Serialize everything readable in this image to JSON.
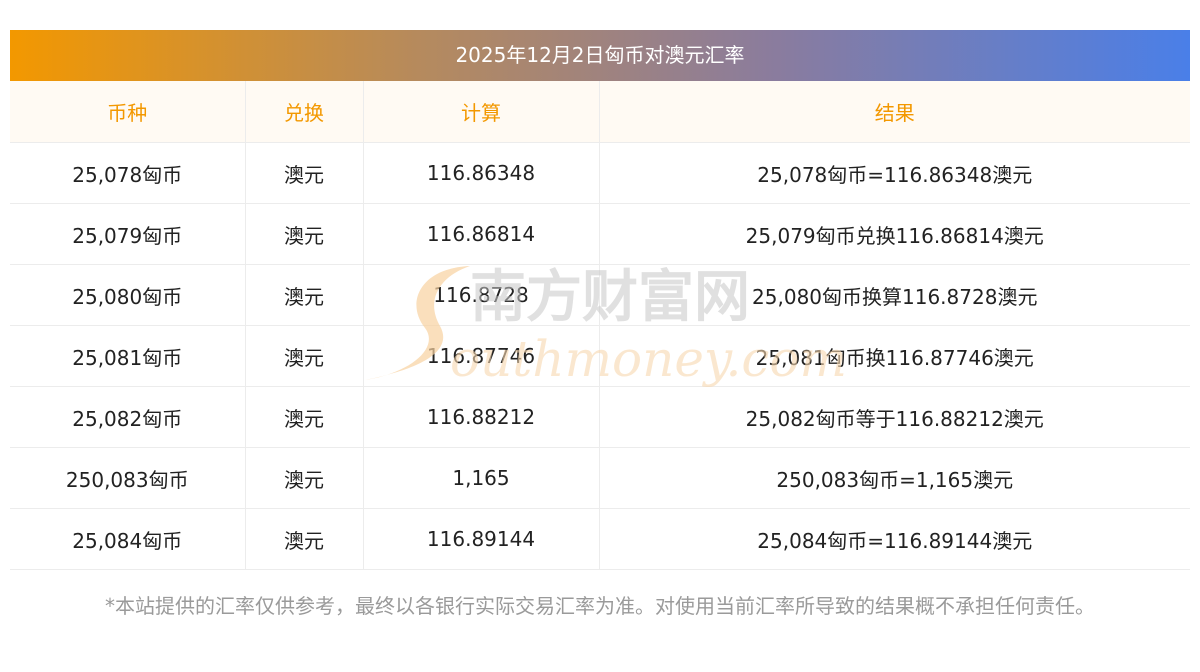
{
  "title": "2025年12月2日匈币对澳元汇率",
  "headers": [
    "币种",
    "兑换",
    "计算",
    "结果"
  ],
  "rows": [
    [
      "25,078匈币",
      "澳元",
      "116.86348",
      "25,078匈币=116.86348澳元"
    ],
    [
      "25,079匈币",
      "澳元",
      "116.86814",
      "25,079匈币兑换116.86814澳元"
    ],
    [
      "25,080匈币",
      "澳元",
      "116.8728",
      "25,080匈币换算116.8728澳元"
    ],
    [
      "25,081匈币",
      "澳元",
      "116.87746",
      "25,081匈币换116.87746澳元"
    ],
    [
      "25,082匈币",
      "澳元",
      "116.88212",
      "25,082匈币等于116.88212澳元"
    ],
    [
      "250,083匈币",
      "澳元",
      "1,165",
      "250,083匈币=1,165澳元"
    ],
    [
      "25,084匈币",
      "澳元",
      "116.89144",
      "25,084匈币=116.89144澳元"
    ]
  ],
  "watermark": {
    "cn": "南方财富网",
    "en": "outhmoney.com"
  },
  "note": "*本站提供的汇率仅供参考，最终以各银行实际交易汇率为准。对使用当前汇率所导致的结果概不承担任何责任。",
  "colors": {
    "header_text": "#f39800",
    "gradient_start": "#f39800",
    "gradient_end": "#4a7fe8"
  }
}
